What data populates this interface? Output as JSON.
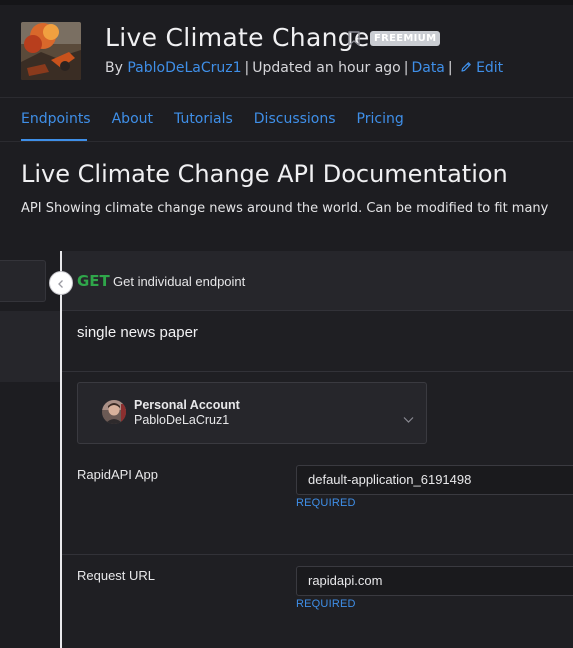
{
  "header": {
    "title": "Live Climate Change",
    "badge": "FREEMIUM",
    "by_prefix": "By",
    "author": "PabloDeLaCruz1",
    "separator": "|",
    "updated": "Updated an hour ago",
    "category": "Data",
    "edit_label": "Edit"
  },
  "tabs": [
    {
      "label": "Endpoints",
      "active": true
    },
    {
      "label": "About"
    },
    {
      "label": "Tutorials"
    },
    {
      "label": "Discussions"
    },
    {
      "label": "Pricing"
    }
  ],
  "doc": {
    "title": "Live Climate Change API Documentation",
    "description": "API Showing climate change news around the world. Can be modified to fit many"
  },
  "endpoint": {
    "method": "GET",
    "name": "Get individual endpoint",
    "description": "single news paper"
  },
  "account": {
    "type": "Personal Account",
    "username": "PabloDeLaCruz1"
  },
  "fields": {
    "app_label": "RapidAPI App",
    "app_value": "default-application_6191498",
    "app_required": "REQUIRED",
    "url_label": "Request URL",
    "url_value": "rapidapi.com",
    "url_required": "REQUIRED"
  },
  "colors": {
    "accent": "#3f8fe8",
    "get_method": "#2fa64a"
  }
}
